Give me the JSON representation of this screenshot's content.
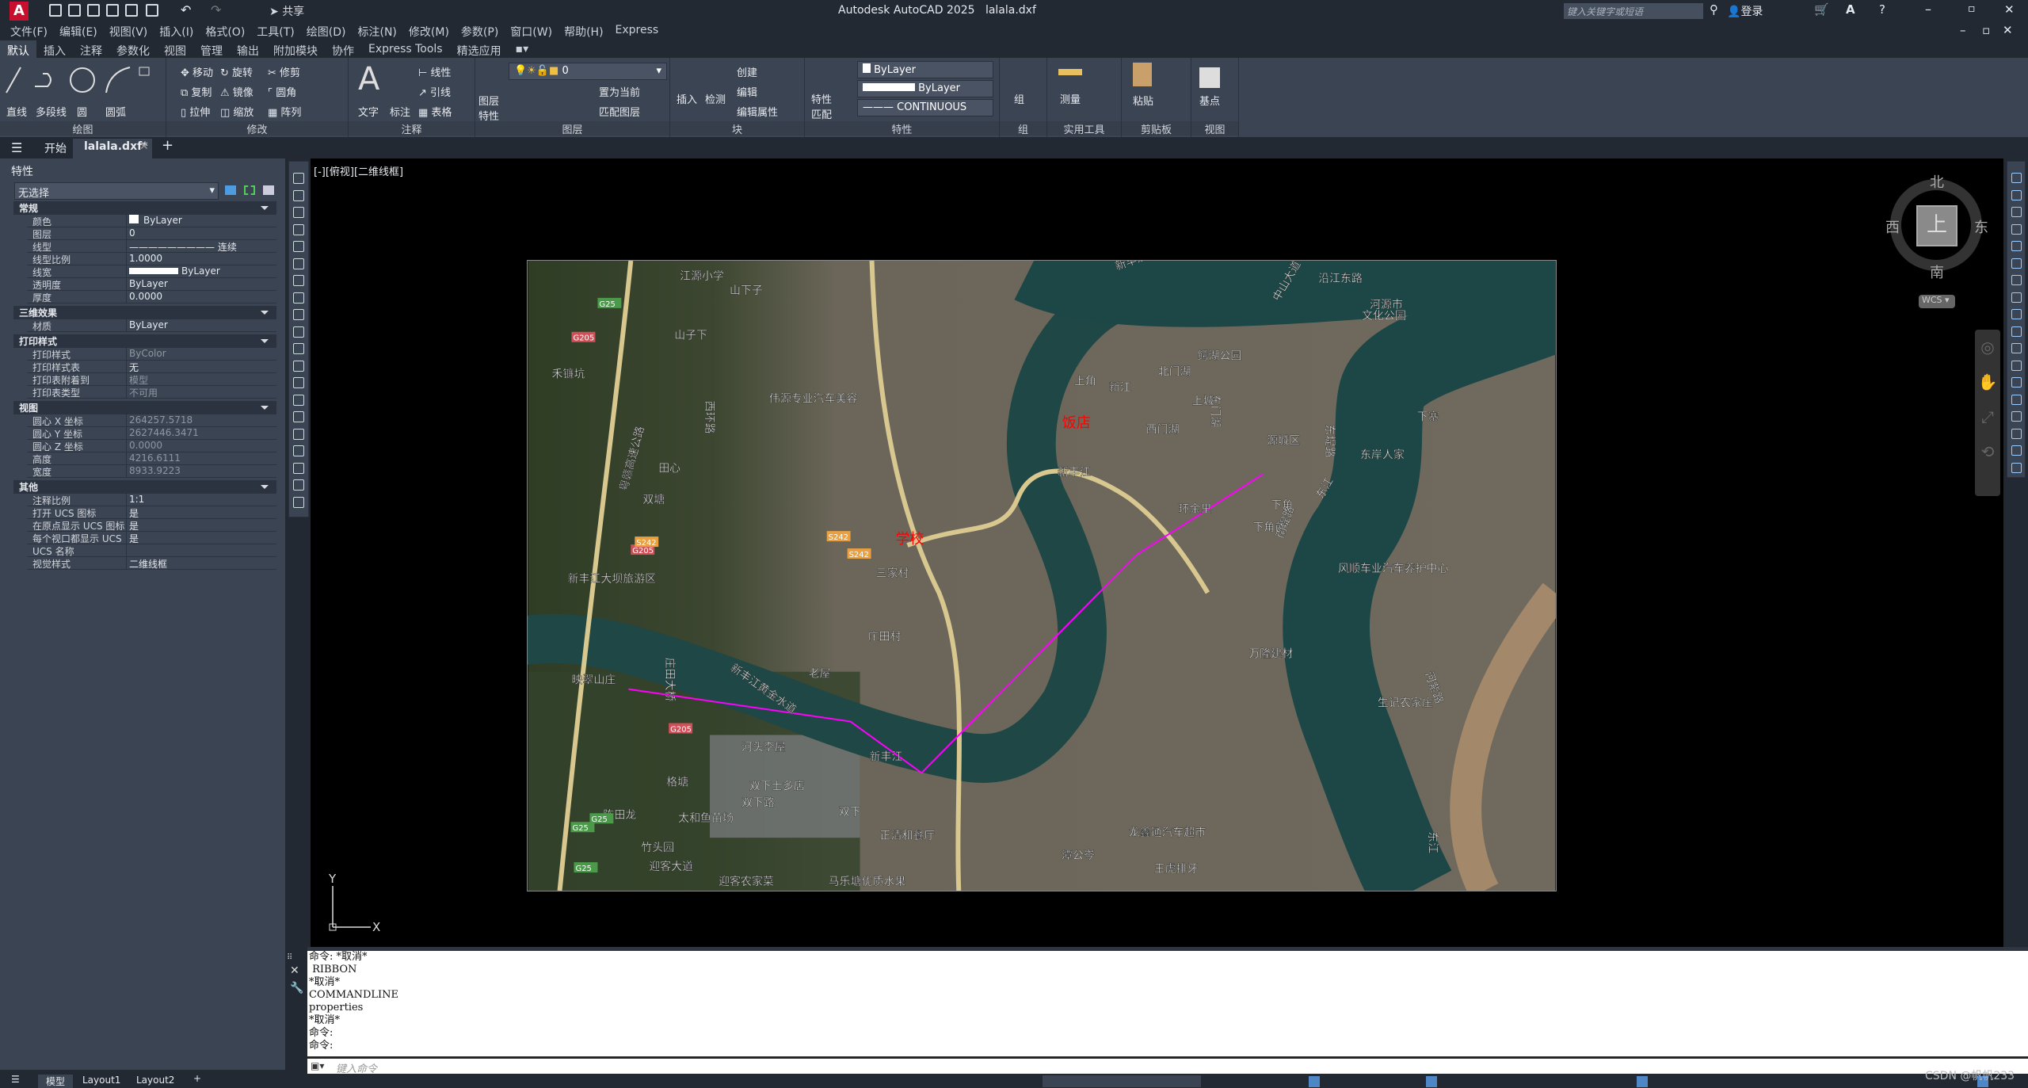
{
  "title": {
    "app": "Autodesk AutoCAD 2025",
    "file": "lalala.dxf",
    "share": "共享",
    "search_placeholder": "键入关键字或短语",
    "login": "登录"
  },
  "menu": [
    "文件(F)",
    "编辑(E)",
    "视图(V)",
    "插入(I)",
    "格式(O)",
    "工具(T)",
    "绘图(D)",
    "标注(N)",
    "修改(M)",
    "参数(P)",
    "窗口(W)",
    "帮助(H)",
    "Express"
  ],
  "ribbon_tabs": [
    "默认",
    "插入",
    "注释",
    "参数化",
    "视图",
    "管理",
    "输出",
    "附加模块",
    "协作",
    "Express Tools",
    "精选应用"
  ],
  "ribbon": {
    "draw": {
      "title": "绘图",
      "items": [
        "直线",
        "多段线",
        "圆",
        "圆弧"
      ]
    },
    "modify": {
      "title": "修改",
      "items": [
        "移动",
        "旋转",
        "修剪",
        "复制",
        "镜像",
        "圆角",
        "拉伸",
        "缩放",
        "阵列"
      ]
    },
    "annotation": {
      "title": "注释",
      "items": [
        "文字",
        "标注",
        "线性",
        "引线",
        "表格"
      ]
    },
    "layers": {
      "title": "图层",
      "layer_props": "图层特性",
      "current_layer": "0",
      "set_current": "置为当前",
      "match_layer": "匹配图层"
    },
    "block": {
      "title": "块",
      "items": [
        "插入",
        "检测",
        "创建",
        "编辑",
        "编辑属性"
      ]
    },
    "properties": {
      "title": "特性",
      "match": "特性匹配",
      "color": "ByLayer",
      "lineweight": "ByLayer",
      "linetype": "CONTINUOUS"
    },
    "groups": {
      "title": "组",
      "label": "组"
    },
    "utilities": {
      "title": "实用工具",
      "measure": "测量"
    },
    "clipboard": {
      "title": "剪贴板",
      "paste": "粘贴"
    },
    "view": {
      "title": "视图",
      "base": "基点"
    }
  },
  "file_tabs": {
    "start": "开始",
    "active": "lalala.dxf*"
  },
  "properties_panel": {
    "title": "特性",
    "selection": "无选择",
    "sections": [
      {
        "name": "常规",
        "rows": [
          [
            "颜色",
            "ByLayer"
          ],
          [
            "图层",
            "0"
          ],
          [
            "线型",
            "连续"
          ],
          [
            "线型比例",
            "1.0000"
          ],
          [
            "线宽",
            "ByLayer"
          ],
          [
            "透明度",
            "ByLayer"
          ],
          [
            "厚度",
            "0.0000"
          ]
        ]
      },
      {
        "name": "三维效果",
        "rows": [
          [
            "材质",
            "ByLayer"
          ]
        ]
      },
      {
        "name": "打印样式",
        "rows": [
          [
            "打印样式",
            "ByColor"
          ],
          [
            "打印样式表",
            "无"
          ],
          [
            "打印表附着到",
            "模型"
          ],
          [
            "打印表类型",
            "不可用"
          ]
        ]
      },
      {
        "name": "视图",
        "rows": [
          [
            "圆心 X 坐标",
            "264257.5718"
          ],
          [
            "圆心 Y 坐标",
            "2627446.3471"
          ],
          [
            "圆心 Z 坐标",
            "0.0000"
          ],
          [
            "高度",
            "4216.6111"
          ],
          [
            "宽度",
            "8933.9223"
          ]
        ]
      },
      {
        "name": "其他",
        "rows": [
          [
            "注释比例",
            "1:1"
          ],
          [
            "打开 UCS 图标",
            "是"
          ],
          [
            "在原点显示 UCS 图标",
            "是"
          ],
          [
            "每个视口都显示 UCS",
            "是"
          ],
          [
            "UCS 名称",
            ""
          ],
          [
            "视觉样式",
            "二维线框"
          ]
        ]
      }
    ]
  },
  "viewport": {
    "label": "[-][俯视][二维线框]",
    "viewcube": {
      "n": "北",
      "s": "南",
      "e": "东",
      "w": "西",
      "top": "上",
      "wcs": "WCS"
    },
    "ucs_x": "X",
    "ucs_y": "Y"
  },
  "map": {
    "annotations": [
      "学校",
      "饭店"
    ],
    "annotation_color": "#ff0000",
    "polyline_color": "#ff00ff",
    "labels": [
      "江源小学",
      "山下子",
      "山子下",
      "禾镰坑",
      "西环路",
      "伟源专业汽车美容",
      "田心",
      "双塘",
      "粤赣高速公路",
      "新丰江大坝旅游区",
      "三家村",
      "新丰江黄金水道",
      "沿江东路",
      "中山大道",
      "河源市",
      "文化公园",
      "鳄湖公园",
      "北门湖",
      "东门湖",
      "上角",
      "新江",
      "上城",
      "西门湖",
      "源城区",
      "东堤路",
      "东岸人家",
      "下寨",
      "新丰江",
      "东江",
      "环金里",
      "下角",
      "下角前",
      "南堤路",
      "风顺车业汽车养护中心",
      "庄田大桥",
      "新丰江黄金水道",
      "映翠山庄",
      "河头李屋",
      "新丰江",
      "双下士多店",
      "双下路",
      "太和鱼苗场",
      "陈田龙",
      "双下",
      "正清和餐厅",
      "竹头园",
      "迎客大道",
      "迎客农家菜",
      "马乐塘优质水果",
      "庄田村",
      "老屋",
      "格塘",
      "万隆建材",
      "生记农家庄",
      "东江",
      "龙鑫通汽车超市",
      "潭公岑",
      "王虎排牙",
      "河紫路"
    ],
    "shields": [
      "G25",
      "G25",
      "G25",
      "G25",
      "G205",
      "G205",
      "G205",
      "S242",
      "S242",
      "S242"
    ]
  },
  "command": {
    "history": [
      "命令: *取消*",
      " RIBBON",
      "*取消*",
      "COMMANDLINE",
      "properties",
      "*取消*",
      "命令:",
      "命令:"
    ],
    "placeholder": "键入命令"
  },
  "status": {
    "tabs": [
      "模型",
      "Layout1",
      "Layout2"
    ],
    "watermark": "CSDN @帆帆233"
  }
}
